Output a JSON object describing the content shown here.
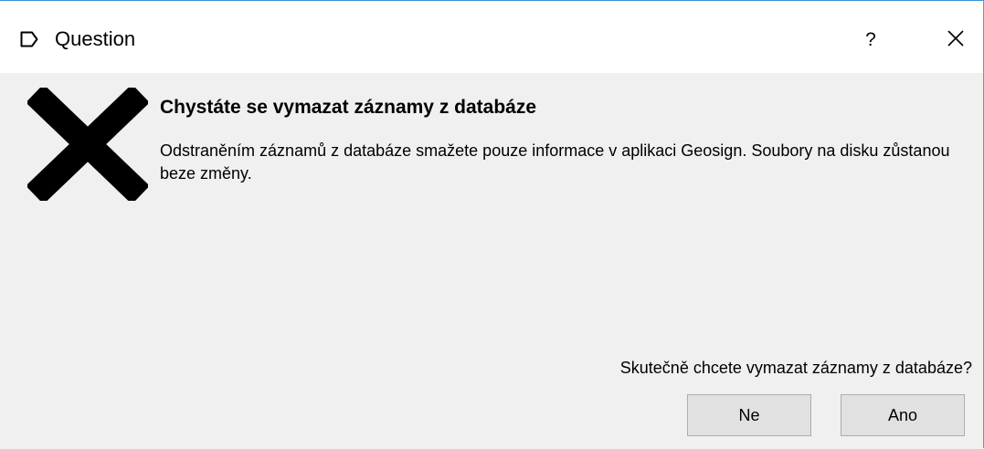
{
  "window": {
    "title": "Question",
    "help_label": "?"
  },
  "icons": {
    "app": "window-icon",
    "error": "error-x-icon",
    "close": "close-icon"
  },
  "message": {
    "heading": "Chystáte se vymazat záznamy z databáze",
    "body": "Odstraněním záznamů z databáze smažete pouze informace v aplikaci Geosign. Soubory na disku zůstanou beze změny.",
    "question": "Skutečně chcete vymazat záznamy z databáze?"
  },
  "buttons": {
    "no_label": "Ne",
    "yes_label": "Ano"
  },
  "colors": {
    "window_border": "#3c8fd8",
    "content_bg": "#f0f0f0",
    "button_bg": "#e1e1e1",
    "button_border": "#adadad"
  }
}
